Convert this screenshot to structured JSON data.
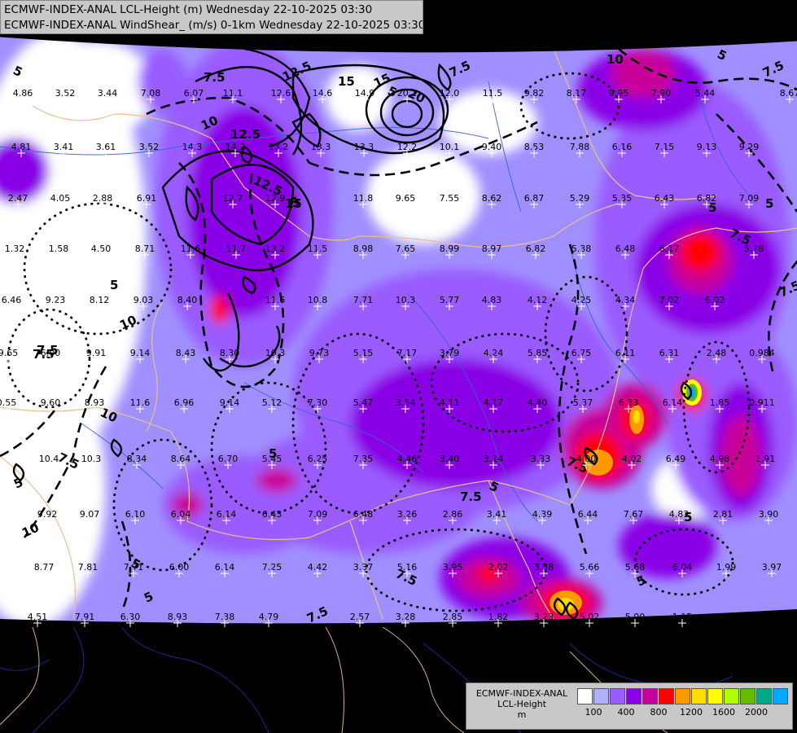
{
  "header": {
    "line1": "ECMWF-INDEX-ANAL LCL-Height (m) Wednesday 22-10-2025 03:30",
    "line2": "ECMWF-INDEX-ANAL WindShear_ (m/s) 0-1km Wednesday 22-10-2025 03:30"
  },
  "legend": {
    "title_line1": "ECMWF-INDEX-ANAL",
    "title_line2": "LCL-Height",
    "unit": "m",
    "colors": [
      "#ffffff",
      "#b0b0ff",
      "#9a5cff",
      "#8a00e6",
      "#c8009a",
      "#ff0000",
      "#ff9900",
      "#ffdd00",
      "#ffff00",
      "#b0ff00",
      "#66bb00",
      "#00aa88",
      "#00aaff"
    ],
    "ticks": [
      "100",
      "400",
      "800",
      "1200",
      "1600",
      "2000"
    ]
  },
  "contour_labels": [
    "12.5",
    "15",
    "20",
    "15",
    "12.5",
    "12.5",
    "10",
    "15",
    "7.5",
    "5",
    "7.5",
    "5",
    "10",
    "7.5",
    "10",
    "10",
    "7.5",
    "5",
    "7.5",
    "10",
    "5",
    "7.5",
    "5",
    "7.5",
    "7.5",
    "5",
    "5",
    "5",
    "7.5",
    "7.5",
    "5",
    "5",
    "7.5",
    "7.5",
    "5",
    "5",
    "5",
    "5"
  ],
  "values": [
    "4.86",
    "3.52",
    "3.44",
    "7.08",
    "6.07",
    "11.1",
    "12.6",
    "14.6",
    "14.9",
    "20.1",
    "12.0",
    "11.5",
    "9.82",
    "8.17",
    "9.95",
    "7.90",
    "5.44",
    "8.67",
    "4.81",
    "3.41",
    "3.61",
    "3.52",
    "14.3",
    "14.2",
    "13.2",
    "13.3",
    "13.3",
    "12.2",
    "10.1",
    "9.40",
    "8.53",
    "7.88",
    "6.16",
    "7.15",
    "9.13",
    "9.29",
    "2.47",
    "4.05",
    "2.88",
    "6.91",
    "12.7",
    "12.9",
    "11.8",
    "9.65",
    "7.55",
    "8.62",
    "6.87",
    "5.29",
    "5.35",
    "6.43",
    "6.82",
    "7.09",
    "1.32",
    "1.58",
    "4.50",
    "8.71",
    "11.6",
    "11.7",
    "13.2",
    "11.5",
    "8.98",
    "7.65",
    "8.99",
    "8.97",
    "6.82",
    "5.38",
    "6.48",
    "6.17",
    "5.78",
    "6.46",
    "9.23",
    "8.12",
    "9.03",
    "8.40",
    "11.6",
    "10.8",
    "7.71",
    "10.3",
    "5.77",
    "4.83",
    "4.12",
    "4.25",
    "4.34",
    "7.02",
    "6.02",
    "9.65",
    "6.00",
    "9.91",
    "9.14",
    "8.43",
    "8.30",
    "10.3",
    "9.73",
    "5.15",
    "7.17",
    "3.79",
    "4.24",
    "5.85",
    "6.75",
    "6.11",
    "6.31",
    "2.48",
    "0.984",
    "0.55",
    "9.60",
    "8.93",
    "11.6",
    "6.96",
    "9.14",
    "5.12",
    "7.30",
    "5.47",
    "3.54",
    "4.11",
    "4.17",
    "4.40",
    "5.37",
    "6.33",
    "6.14",
    "1.85",
    "0.911",
    "10.4",
    "10.3",
    "8.34",
    "8.64",
    "6.70",
    "5.45",
    "6.25",
    "7.35",
    "4.46",
    "3.40",
    "3.14",
    "3.33",
    "4.00",
    "4.02",
    "6.49",
    "4.98",
    "1.91",
    "9.92",
    "9.07",
    "6.10",
    "6.04",
    "6.14",
    "6.43",
    "7.09",
    "6.48",
    "3.26",
    "2.86",
    "3.41",
    "4.39",
    "6.44",
    "7.67",
    "4.83",
    "2.81",
    "3.90",
    "8.77",
    "7.81",
    "7.71",
    "6.00",
    "6.14",
    "7.25",
    "4.42",
    "3.37",
    "5.16",
    "3.95",
    "2.02",
    "3.38",
    "5.66",
    "5.68",
    "6.04",
    "1.99",
    "3.97",
    "4.51",
    "7.91",
    "6.30",
    "8.93",
    "7.38",
    "4.79",
    "2.57",
    "3.28",
    "2.85",
    "1.82",
    "3.23",
    "5.02",
    "5.00",
    "1.15"
  ]
}
